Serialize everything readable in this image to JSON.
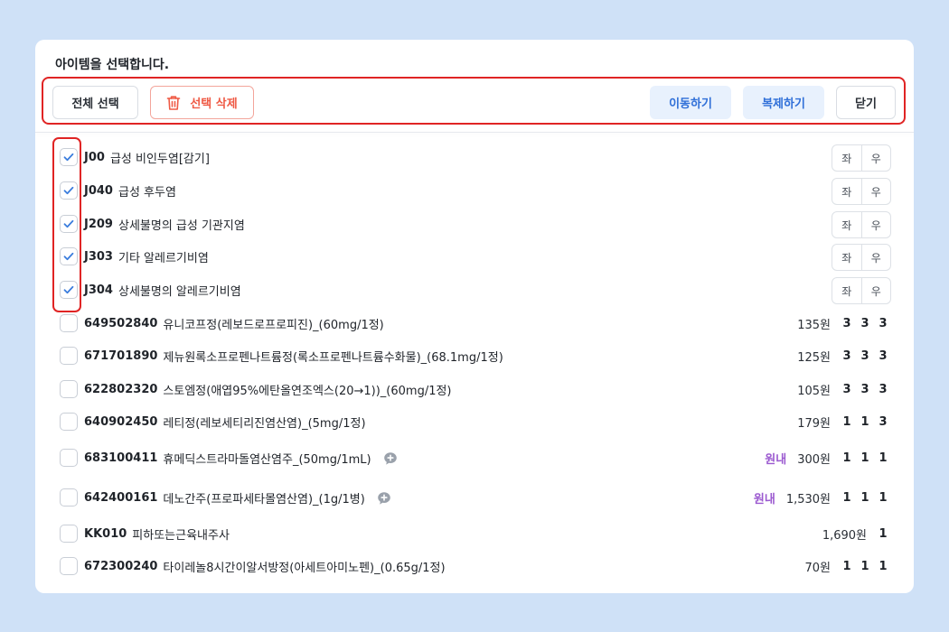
{
  "panel": {
    "title": "아이템을 선택합니다."
  },
  "toolbar": {
    "select_all": "전체 선택",
    "delete_selected": "선택 삭제",
    "move": "이동하기",
    "copy": "복제하기",
    "close": "닫기"
  },
  "colors": {
    "accent": "#2f6fd8",
    "danger": "#ef5a45",
    "highlight": "#e02424",
    "inhouse": "#9b59d0",
    "background": "#cfe1f7"
  },
  "lr_labels": {
    "left": "좌",
    "right": "우"
  },
  "diagnoses": [
    {
      "code": "J00",
      "name": "급성 비인두염[감기]",
      "checked": true
    },
    {
      "code": "J040",
      "name": "급성 후두염",
      "checked": true
    },
    {
      "code": "J209",
      "name": "상세불명의 급성 기관지염",
      "checked": true
    },
    {
      "code": "J303",
      "name": "기타 알레르기비염",
      "checked": true
    },
    {
      "code": "J304",
      "name": "상세불명의 알레르기비염",
      "checked": true
    }
  ],
  "prescriptions": [
    {
      "code": "649502840",
      "name": "유니코프정(레보드로프로피진)_(60mg/1정)",
      "inhouse": "",
      "price": "135원",
      "doses": [
        "3",
        "3",
        "3"
      ],
      "note_icon": false,
      "checked": false
    },
    {
      "code": "671701890",
      "name": "제뉴원록소프로펜나트륨정(록소프로펜나트륨수화물)_(68.1mg/1정)",
      "inhouse": "",
      "price": "125원",
      "doses": [
        "3",
        "3",
        "3"
      ],
      "note_icon": false,
      "checked": false
    },
    {
      "code": "622802320",
      "name": "스토엠정(애엽95%에탄올연조엑스(20→1))_(60mg/1정)",
      "inhouse": "",
      "price": "105원",
      "doses": [
        "3",
        "3",
        "3"
      ],
      "note_icon": false,
      "checked": false
    },
    {
      "code": "640902450",
      "name": "레티정(레보세티리진염산염)_(5mg/1정)",
      "inhouse": "",
      "price": "179원",
      "doses": [
        "1",
        "1",
        "3"
      ],
      "note_icon": false,
      "checked": false
    },
    {
      "code": "683100411",
      "name": "휴메딕스트라마돌염산염주_(50mg/1mL)",
      "inhouse": "원내",
      "price": "300원",
      "doses": [
        "1",
        "1",
        "1"
      ],
      "note_icon": true,
      "checked": false
    },
    {
      "code": "642400161",
      "name": "데노간주(프로파세타몰염산염)_(1g/1병)",
      "inhouse": "원내",
      "price": "1,530원",
      "doses": [
        "1",
        "1",
        "1"
      ],
      "note_icon": true,
      "checked": false
    },
    {
      "code": "KK010",
      "name": "피하또는근육내주사",
      "inhouse": "",
      "price": "1,690원",
      "doses": [
        "1"
      ],
      "note_icon": false,
      "checked": false
    },
    {
      "code": "672300240",
      "name": "타이레놀8시간이알서방정(아세트아미노펜)_(0.65g/1정)",
      "inhouse": "",
      "price": "70원",
      "doses": [
        "1",
        "1",
        "1"
      ],
      "note_icon": false,
      "checked": false
    }
  ]
}
